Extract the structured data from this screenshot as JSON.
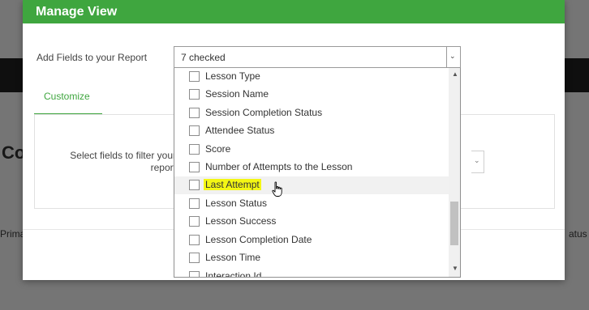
{
  "background": {
    "heading_fragment": "Co",
    "left_col_fragment": "Prima",
    "right_col_fragment": "atus"
  },
  "modal": {
    "title": "Manage View",
    "add_fields_label": "Add Fields to your Report",
    "tab_label": "Customize",
    "filter_label": "Select fields to filter your report",
    "accent_color": "#3fa63f"
  },
  "select": {
    "value": "7 checked"
  },
  "dropdown": {
    "options": [
      {
        "label": "Lesson Type",
        "checked": false
      },
      {
        "label": "Session Name",
        "checked": false
      },
      {
        "label": "Session Completion Status",
        "checked": false
      },
      {
        "label": "Attendee Status",
        "checked": false
      },
      {
        "label": "Score",
        "checked": false
      },
      {
        "label": "Number of Attempts to the Lesson",
        "checked": false
      },
      {
        "label": "Last Attempt",
        "checked": false,
        "highlighted": true,
        "hovered": true
      },
      {
        "label": "Lesson Status",
        "checked": false
      },
      {
        "label": "Lesson Success",
        "checked": false
      },
      {
        "label": "Lesson Completion Date",
        "checked": false
      },
      {
        "label": "Lesson Time",
        "checked": false
      },
      {
        "label": "Interaction Id",
        "checked": false
      }
    ],
    "highlight_color": "#f4f714"
  },
  "icons": {
    "select_arrow": "chevron-down-icon",
    "scroll_up": "triangle-up-icon",
    "scroll_down": "triangle-down-icon",
    "cursor": "hand-pointer-icon"
  }
}
